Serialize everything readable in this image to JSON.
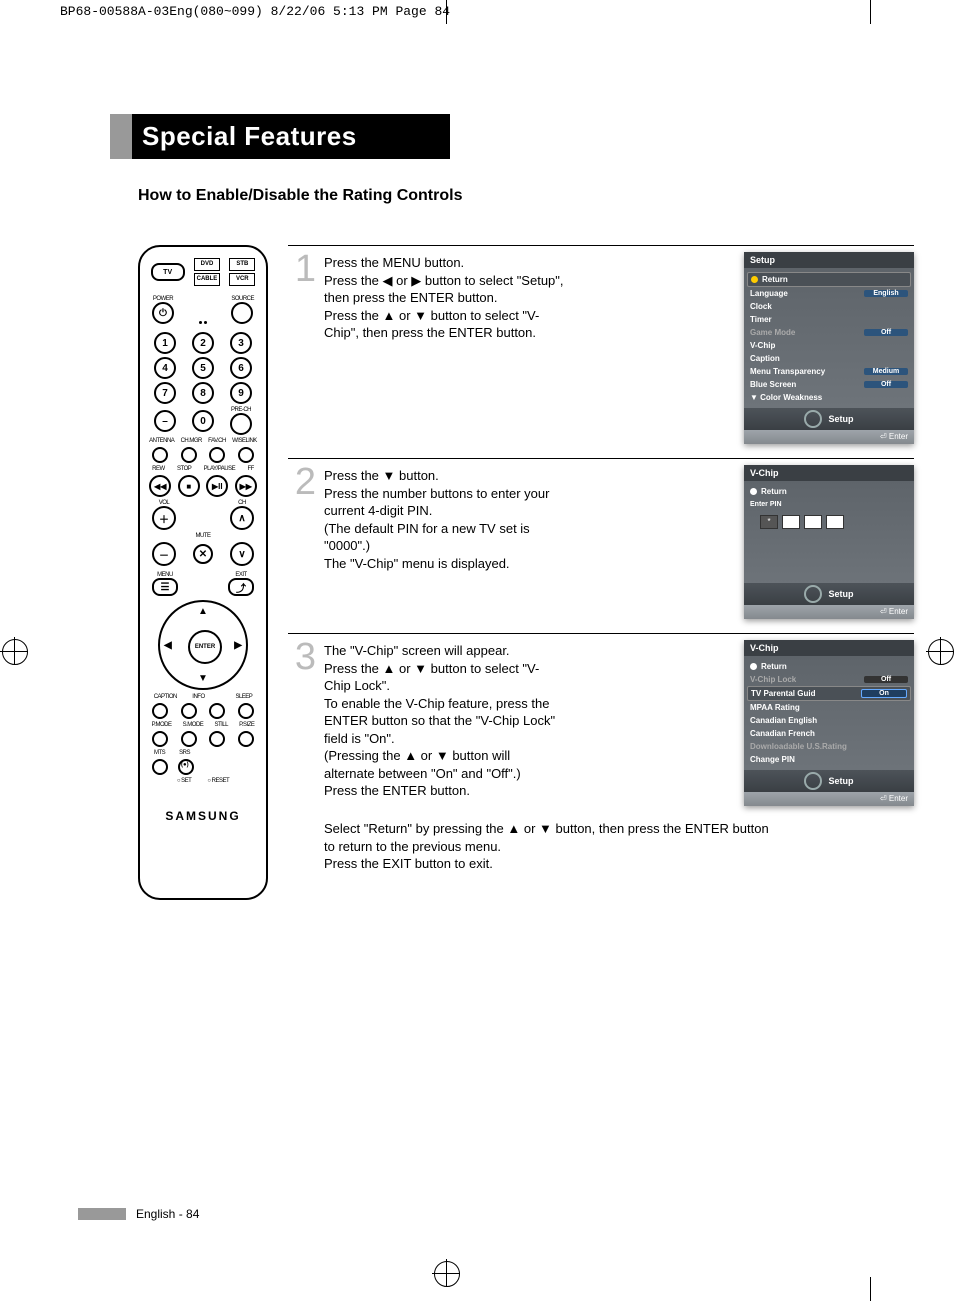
{
  "top_note": "BP68-00588A-03Eng(080~099)  8/22/06  5:13 PM  Page 84",
  "section_title": "Special Features",
  "section_subtitle": "How to Enable/Disable the Rating Controls",
  "steps": [
    {
      "num": "1",
      "lines": [
        "Press the MENU button.",
        "Press the ◀ or ▶ button to select \"Setup\", then press  the ENTER button.",
        "Press the ▲ or ▼ button to select \"V-Chip\", then press the ENTER button."
      ]
    },
    {
      "num": "2",
      "lines": [
        "Press the ▼ button.",
        "Press the number buttons to enter your current 4-digit PIN.",
        "(The default PIN for a new TV set is \"0000\".)",
        "The \"V-Chip\" menu is displayed."
      ]
    },
    {
      "num": "3",
      "lines": [
        "The \"V-Chip\" screen will appear.",
        "Press the ▲ or ▼ button to select \"V-Chip Lock\".",
        "To enable the V-Chip feature, press the ENTER button so that the \"V-Chip Lock\" field is \"On\".",
        "(Pressing the ▲ or ▼ button will alternate between \"On\" and \"Off\".)",
        "Press the ENTER button."
      ]
    }
  ],
  "step_extra": "Select \"Return\" by pressing the ▲ or ▼ button, then press the ENTER button to return to the previous menu.\nPress the EXIT button to exit.",
  "osd1": {
    "title": "Setup",
    "return": "Return",
    "items": [
      {
        "label": "Language",
        "value": "English",
        "hl": true
      },
      {
        "label": "Clock"
      },
      {
        "label": "Timer"
      },
      {
        "label": "Game Mode",
        "value": "Off",
        "dim": true,
        "hl": true
      },
      {
        "label": "V-Chip"
      },
      {
        "label": "Caption"
      },
      {
        "label": "Menu Transparency",
        "value": "Medium",
        "hl": true
      },
      {
        "label": "Blue Screen",
        "value": "Off",
        "hl": true
      },
      {
        "label": "▼ Color Weakness"
      }
    ],
    "footer1": "Setup",
    "footer2": "Enter"
  },
  "osd2": {
    "title": "V-Chip",
    "return": "Return",
    "enter_pin": "Enter PIN",
    "footer1": "Setup",
    "footer2": "Enter"
  },
  "osd3": {
    "title": "V-Chip",
    "return": "Return",
    "items": [
      {
        "label": "V-Chip Lock",
        "value": "Off",
        "dim": true,
        "hl": true
      },
      {
        "label": "TV Parental Guid",
        "value": "On",
        "hl": true,
        "sel": true
      },
      {
        "label": "MPAA Rating"
      },
      {
        "label": "Canadian English"
      },
      {
        "label": "Canadian French"
      },
      {
        "label": "Downloadable U.S.Rating",
        "dim": true
      },
      {
        "label": "Change PIN"
      }
    ],
    "footer1": "Setup",
    "footer2": "Enter"
  },
  "remote": {
    "top_modes": [
      "TV",
      "DVD",
      "STB",
      "CABLE",
      "VCR"
    ],
    "power": "POWER",
    "source": "SOURCE",
    "nums": [
      "1",
      "2",
      "3",
      "4",
      "5",
      "6",
      "7",
      "8",
      "9",
      "0"
    ],
    "dash": "—",
    "prech": "PRE-CH",
    "row_lbls1": [
      "ANTENNA",
      "CH.MGR",
      "FAV.CH",
      "WISELINK"
    ],
    "row_lbls2": [
      "REW",
      "STOP",
      "PLAY/PAUSE",
      "FF"
    ],
    "transport": [
      "◀◀",
      "■",
      "▶II",
      "▶▶"
    ],
    "vol": "VOL",
    "ch": "CH",
    "mute": "MUTE",
    "menu": "MENU",
    "exit": "EXIT",
    "enter": "ENTER",
    "row_lbls3": [
      "CAPTION",
      "INFO",
      "",
      "SLEEP"
    ],
    "row_lbls4": [
      "P.MODE",
      "S.MODE",
      "STILL",
      "P.SIZE"
    ],
    "row_lbls5": [
      "MTS",
      "SRS"
    ],
    "bottom": [
      "SET",
      "RESET"
    ],
    "brand": "SAMSUNG"
  },
  "page_footer": "English - 84"
}
